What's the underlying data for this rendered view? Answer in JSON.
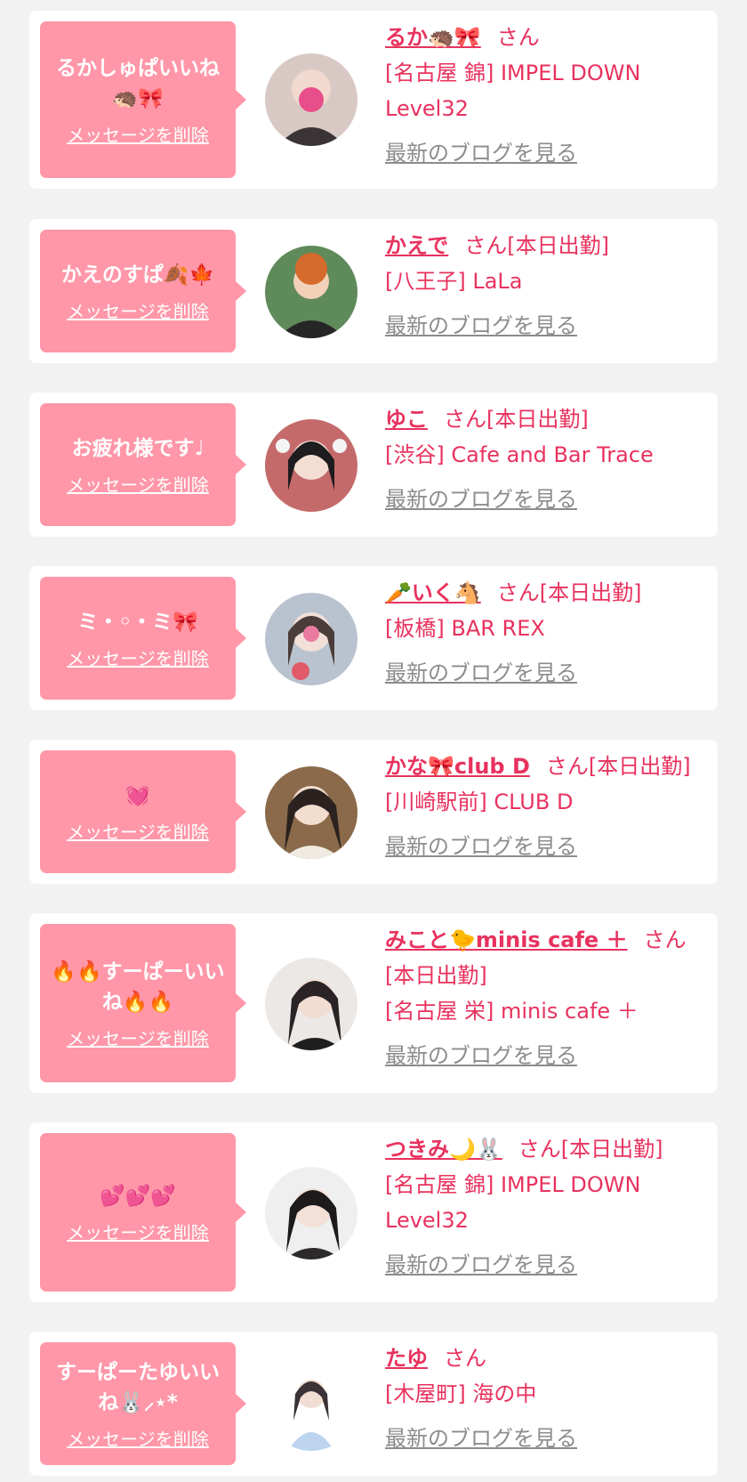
{
  "delete_label": "メッセージを削除",
  "blog_label": "最新のブログを見る",
  "colors": {
    "accent": "#e8325e",
    "bubble": "#ff97a8",
    "link_gray": "#8c8c8c"
  },
  "entries": [
    {
      "message": "るかしゅぱいいね🦔🎀",
      "name": "るか🦔🎀",
      "suffix": "さん",
      "shop": "[名古屋 錦] IMPEL DOWN Level32"
    },
    {
      "message": "かえのすぱ🍂🍁",
      "name": "かえで",
      "suffix": "さん[本日出勤]",
      "shop": "[八王子] LaLa"
    },
    {
      "message": "お疲れ様です♩",
      "name": "ゆこ",
      "suffix": "さん[本日出勤]",
      "shop": "[渋谷] Cafe and Bar Trace"
    },
    {
      "message": "ミ・◦・ミ🎀",
      "name": "🥕いく🐴",
      "suffix": "さん[本日出勤]",
      "shop": "[板橋] BAR REX"
    },
    {
      "message": "💓",
      "name": "かな🎀club D",
      "suffix": "さん[本日出勤]",
      "shop": "[川崎駅前] CLUB D"
    },
    {
      "message": "🔥🔥すーぱーいいね🔥🔥",
      "name": "みこと🐤minis cafe ＋",
      "suffix": "さん[本日出勤]",
      "shop": "[名古屋 栄] minis cafe ＋"
    },
    {
      "message": "💕💕💕",
      "name": "つきみ🌙🐰",
      "suffix": "さん[本日出勤]",
      "shop": "[名古屋 錦] IMPEL DOWN Level32"
    },
    {
      "message": "すーぱーたゆいいね🐰⸝⋆*",
      "name": "たゆ",
      "suffix": "さん",
      "shop": "[木屋町] 海の中"
    }
  ]
}
